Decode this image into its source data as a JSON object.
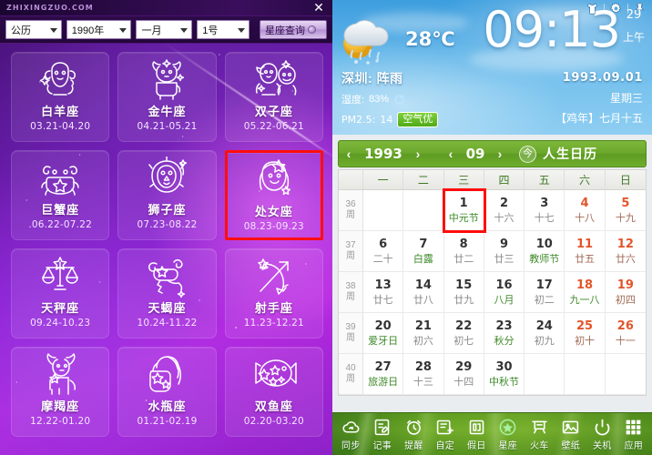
{
  "zodiac": {
    "brand": "ZHIXINGZUO.COM",
    "close_label": "✕",
    "toolbar": {
      "calendar_type": "公历",
      "year": "1990年",
      "month": "一月",
      "day": "1号",
      "query_button": "星座查询"
    },
    "signs": [
      {
        "name": "白羊座",
        "dates": "03.21-04.20",
        "icon": "aries-icon",
        "selected": false
      },
      {
        "name": "金牛座",
        "dates": "04.21-05.21",
        "icon": "taurus-icon",
        "selected": false
      },
      {
        "name": "双子座",
        "dates": "05.22-06.21",
        "icon": "gemini-icon",
        "selected": false
      },
      {
        "name": "巨蟹座",
        "dates": ".06.22-07.22",
        "icon": "cancer-icon",
        "selected": false
      },
      {
        "name": "狮子座",
        "dates": "07.23-08.22",
        "icon": "leo-icon",
        "selected": false
      },
      {
        "name": "处女座",
        "dates": "08.23-09.23",
        "icon": "virgo-icon",
        "selected": true
      },
      {
        "name": "天秤座",
        "dates": "09.24-10.23",
        "icon": "libra-icon",
        "selected": false
      },
      {
        "name": "天蝎座",
        "dates": "10.24-11.22",
        "icon": "scorpio-icon",
        "selected": false
      },
      {
        "name": "射手座",
        "dates": "11.23-12.21",
        "icon": "sagittarius-icon",
        "selected": false
      },
      {
        "name": "摩羯座",
        "dates": "12.22-01.20",
        "icon": "capricorn-icon",
        "selected": false
      },
      {
        "name": "水瓶座",
        "dates": "01.21-02.19",
        "icon": "aquarius-icon",
        "selected": false
      },
      {
        "name": "双鱼座",
        "dates": "02.20-03.20",
        "icon": "pisces-icon",
        "selected": false
      }
    ]
  },
  "calendar_widget": {
    "header_icons": [
      "shirt-skin-icon",
      "gear-icon",
      "pin-icon"
    ],
    "weather": {
      "icon": "sun-behind-rain-cloud-icon",
      "temperature": "28℃",
      "city_condition": "深圳: 阵雨",
      "humidity_label": "湿度:",
      "humidity_value": "83%",
      "refresh_icon": "refresh-icon",
      "pm_label": "PM2.5:",
      "pm_value": "14",
      "air_quality": "空气优"
    },
    "clock": {
      "time": "09:13",
      "seconds": "29",
      "ampm": "上午"
    },
    "date_info": {
      "date": "1993.09.01",
      "weekday": "星期三",
      "lunar": "【鸡年】七月十五"
    },
    "nav": {
      "prev_year": "‹",
      "year": "1993",
      "next_year": "›",
      "prev_month": "‹",
      "month": "09",
      "next_month": "›",
      "today_button": "今",
      "brand": "人生日历"
    },
    "weekday_headers": [
      "",
      "一",
      "二",
      "三",
      "四",
      "五",
      "六",
      "日"
    ],
    "weeks": [
      {
        "week_no": "36",
        "week_unit": "周",
        "days": [
          {
            "num": "",
            "sub": "",
            "weekend": false,
            "festival": false,
            "today": false
          },
          {
            "num": "",
            "sub": "",
            "weekend": false,
            "festival": false,
            "today": false
          },
          {
            "num": "1",
            "sub": "中元节",
            "weekend": false,
            "festival": true,
            "today": true
          },
          {
            "num": "2",
            "sub": "十六",
            "weekend": false,
            "festival": false,
            "today": false
          },
          {
            "num": "3",
            "sub": "十七",
            "weekend": false,
            "festival": false,
            "today": false
          },
          {
            "num": "4",
            "sub": "十八",
            "weekend": true,
            "festival": false,
            "today": false
          },
          {
            "num": "5",
            "sub": "十九",
            "weekend": true,
            "festival": false,
            "today": false
          }
        ]
      },
      {
        "week_no": "37",
        "week_unit": "周",
        "days": [
          {
            "num": "6",
            "sub": "二十",
            "weekend": false,
            "festival": false,
            "today": false
          },
          {
            "num": "7",
            "sub": "白露",
            "weekend": false,
            "festival": true,
            "today": false
          },
          {
            "num": "8",
            "sub": "廿二",
            "weekend": false,
            "festival": false,
            "today": false
          },
          {
            "num": "9",
            "sub": "廿三",
            "weekend": false,
            "festival": false,
            "today": false
          },
          {
            "num": "10",
            "sub": "教师节",
            "weekend": false,
            "festival": true,
            "today": false
          },
          {
            "num": "11",
            "sub": "廿五",
            "weekend": true,
            "festival": false,
            "today": false
          },
          {
            "num": "12",
            "sub": "廿六",
            "weekend": true,
            "festival": false,
            "today": false
          }
        ]
      },
      {
        "week_no": "38",
        "week_unit": "周",
        "days": [
          {
            "num": "13",
            "sub": "廿七",
            "weekend": false,
            "festival": false,
            "today": false
          },
          {
            "num": "14",
            "sub": "廿八",
            "weekend": false,
            "festival": false,
            "today": false
          },
          {
            "num": "15",
            "sub": "廿九",
            "weekend": false,
            "festival": false,
            "today": false
          },
          {
            "num": "16",
            "sub": "八月",
            "weekend": false,
            "festival": true,
            "today": false
          },
          {
            "num": "17",
            "sub": "初二",
            "weekend": false,
            "festival": false,
            "today": false
          },
          {
            "num": "18",
            "sub": "九一八",
            "weekend": true,
            "festival": true,
            "today": false
          },
          {
            "num": "19",
            "sub": "初四",
            "weekend": true,
            "festival": false,
            "today": false
          }
        ]
      },
      {
        "week_no": "39",
        "week_unit": "周",
        "days": [
          {
            "num": "20",
            "sub": "爱牙日",
            "weekend": false,
            "festival": true,
            "today": false
          },
          {
            "num": "21",
            "sub": "初六",
            "weekend": false,
            "festival": false,
            "today": false
          },
          {
            "num": "22",
            "sub": "初七",
            "weekend": false,
            "festival": false,
            "today": false
          },
          {
            "num": "23",
            "sub": "秋分",
            "weekend": false,
            "festival": true,
            "today": false
          },
          {
            "num": "24",
            "sub": "初九",
            "weekend": false,
            "festival": false,
            "today": false
          },
          {
            "num": "25",
            "sub": "初十",
            "weekend": true,
            "festival": false,
            "today": false
          },
          {
            "num": "26",
            "sub": "十一",
            "weekend": true,
            "festival": false,
            "today": false
          }
        ]
      },
      {
        "week_no": "40",
        "week_unit": "周",
        "days": [
          {
            "num": "27",
            "sub": "旅游日",
            "weekend": false,
            "festival": true,
            "today": false
          },
          {
            "num": "28",
            "sub": "十三",
            "weekend": false,
            "festival": false,
            "today": false
          },
          {
            "num": "29",
            "sub": "十四",
            "weekend": false,
            "festival": false,
            "today": false
          },
          {
            "num": "30",
            "sub": "中秋节",
            "weekend": false,
            "festival": true,
            "today": false
          },
          {
            "num": "",
            "sub": "",
            "weekend": false,
            "festival": false,
            "today": false
          },
          {
            "num": "",
            "sub": "",
            "weekend": true,
            "festival": false,
            "today": false
          },
          {
            "num": "",
            "sub": "",
            "weekend": true,
            "festival": false,
            "today": false
          }
        ]
      }
    ],
    "dock": [
      {
        "label": "同步",
        "icon": "cloud-sync-icon"
      },
      {
        "label": "记事",
        "icon": "note-icon"
      },
      {
        "label": "提醒",
        "icon": "alarm-clock-icon"
      },
      {
        "label": "自定",
        "icon": "custom-festival-icon"
      },
      {
        "label": "假日",
        "icon": "holiday-icon"
      },
      {
        "label": "星座",
        "icon": "star-icon"
      },
      {
        "label": "火车",
        "icon": "train-icon"
      },
      {
        "label": "壁纸",
        "icon": "wallpaper-icon"
      },
      {
        "label": "关机",
        "icon": "power-icon"
      },
      {
        "label": "应用",
        "icon": "apps-grid-icon"
      }
    ]
  },
  "colors": {
    "zodiac_accent": "#b52ae0",
    "selection_red": "#ff0d0d",
    "calendar_green": "#6aa82b",
    "sky_blue": "#4ea8e3",
    "weekend_orange": "#e2552a",
    "festival_green": "#3f8a2a"
  }
}
